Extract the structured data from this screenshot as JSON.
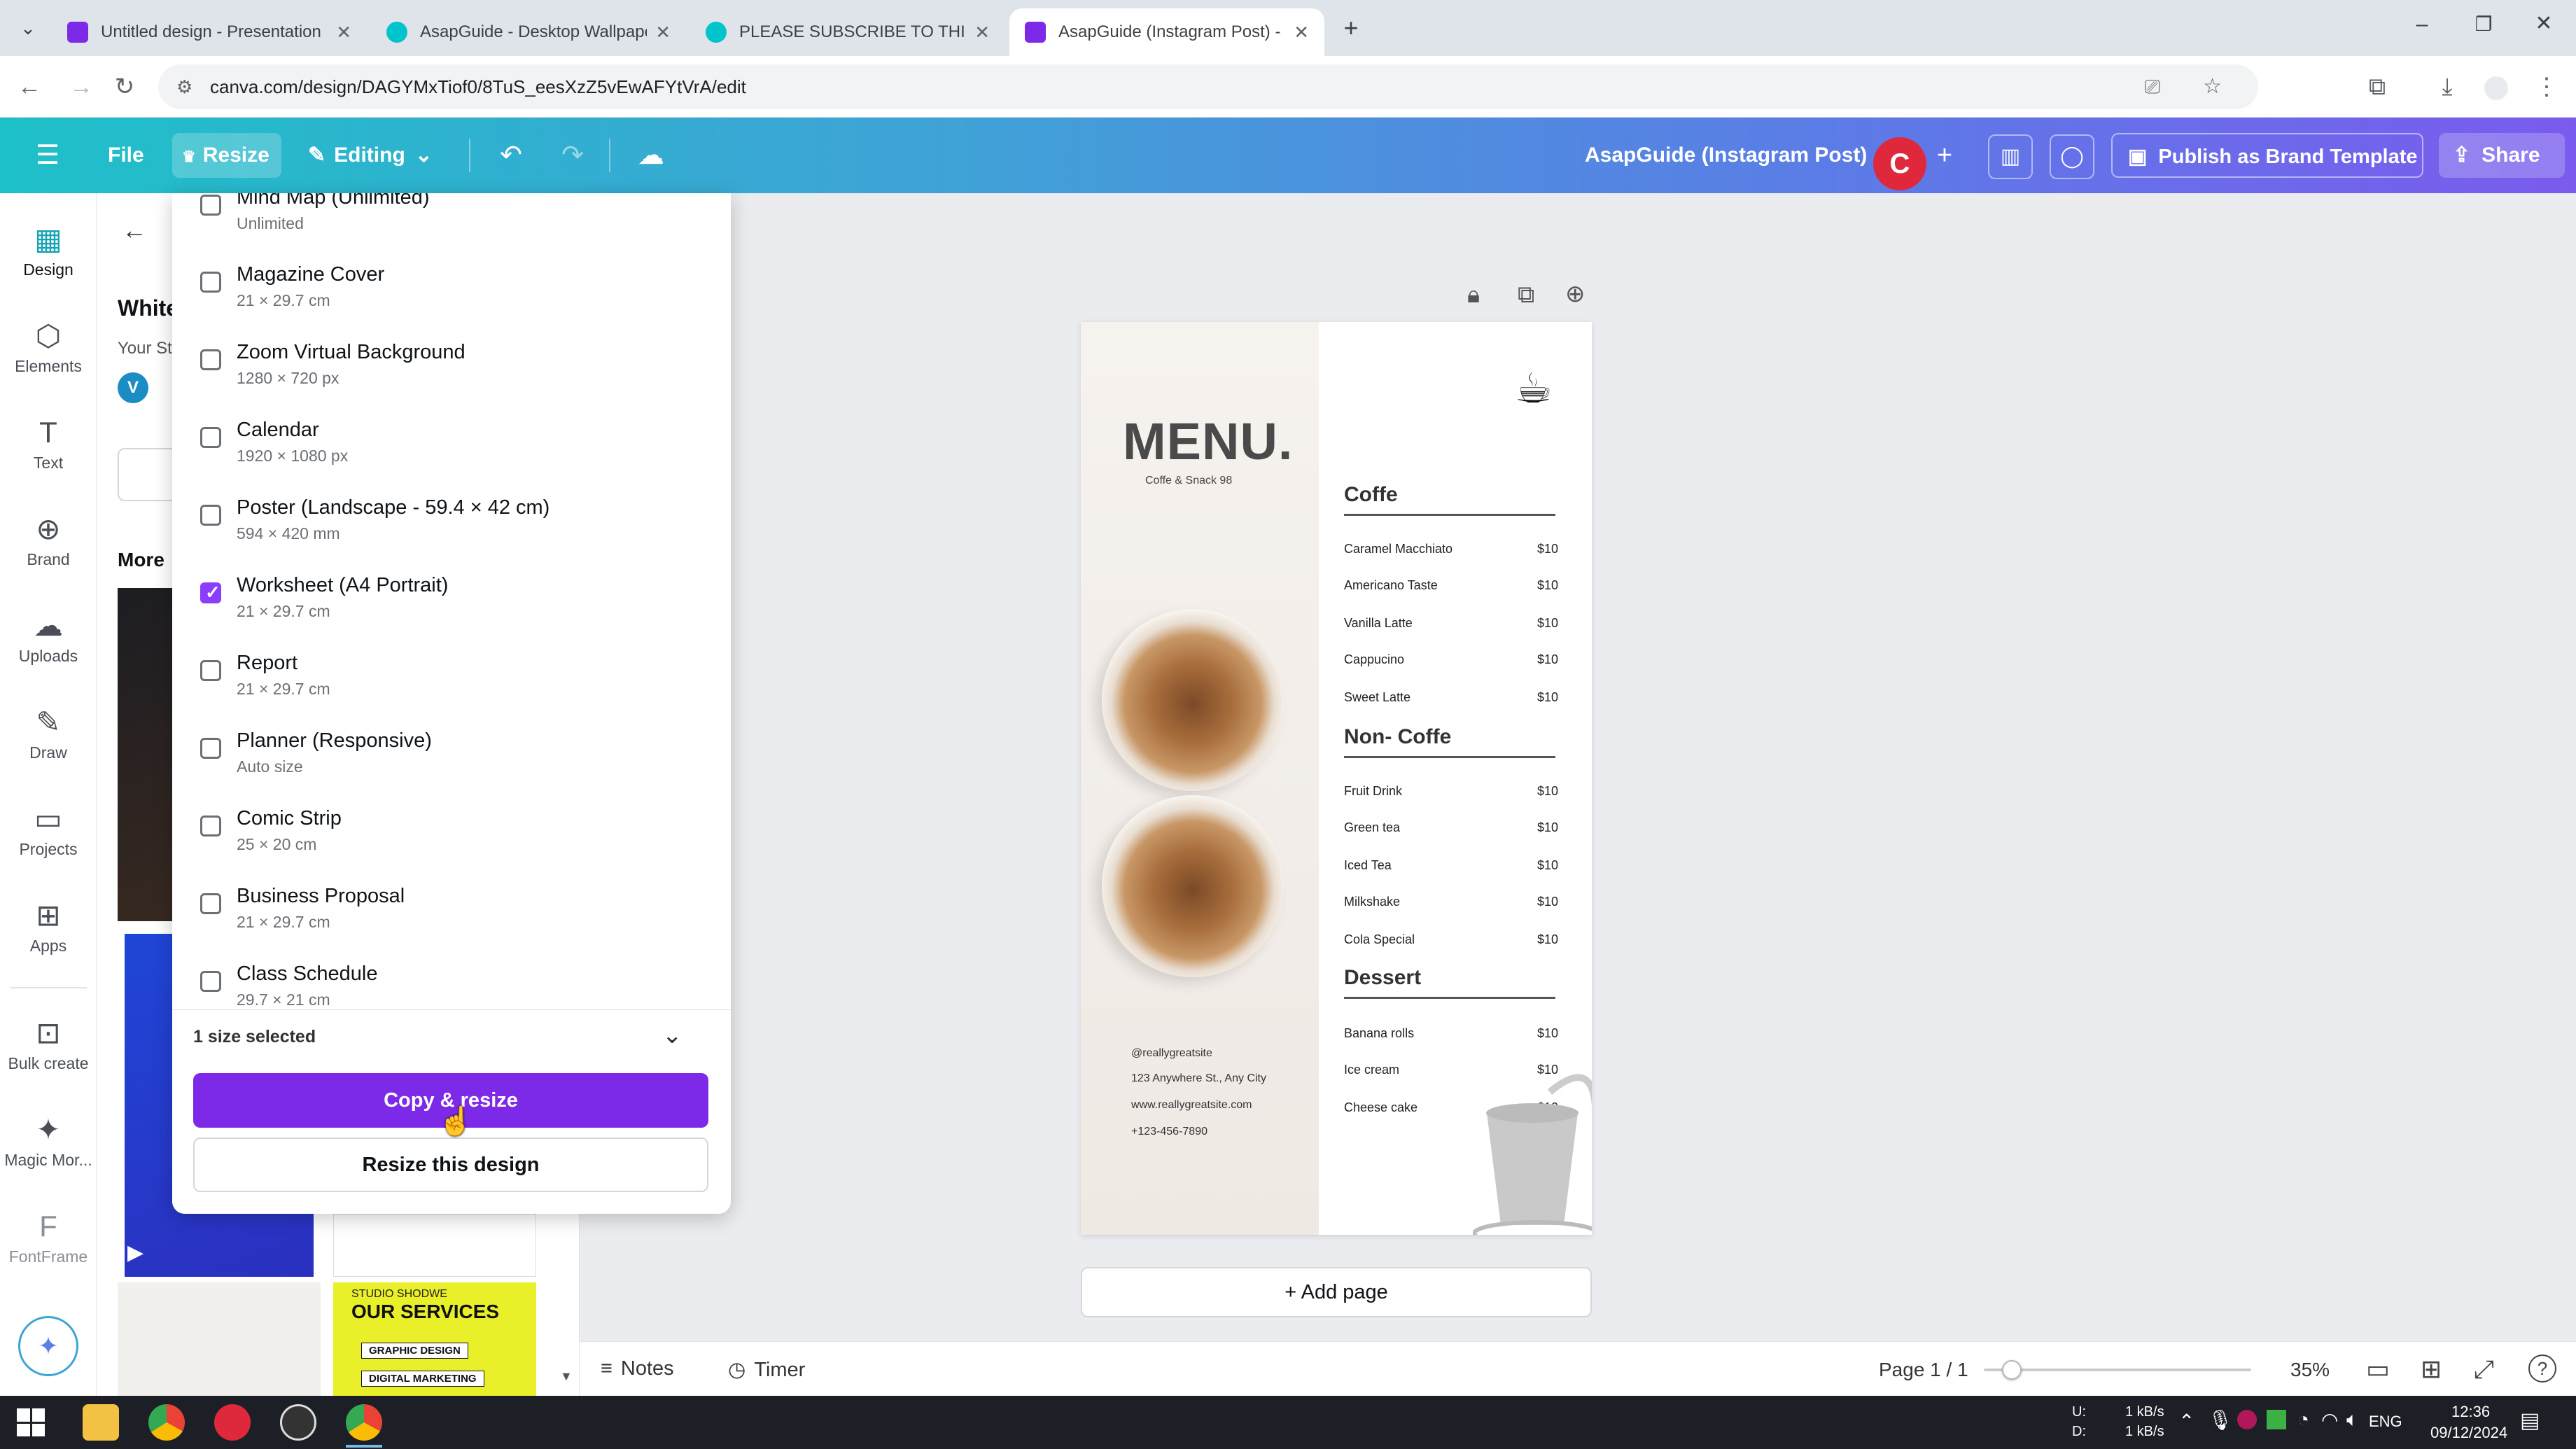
{
  "browser": {
    "tabs": [
      {
        "title": "Untitled design - Presentation",
        "fav_color": "#7d2ae8"
      },
      {
        "title": "AsapGuide - Desktop Wallpape",
        "fav_color": "#00c4cc"
      },
      {
        "title": "PLEASE SUBSCRIBE TO THIS CH",
        "fav_color": "#00c4cc"
      },
      {
        "title": "AsapGuide (Instagram Post) - Y",
        "fav_color": "#7d2ae8"
      }
    ],
    "url": "canva.com/design/DAGYMxTiof0/8TuS_eesXzZ5vEwAFYtVrA/edit"
  },
  "header": {
    "file": "File",
    "resize": "Resize",
    "editing": "Editing",
    "design_title": "AsapGuide (Instagram Post)",
    "avatar_letter": "C",
    "publish": "Publish as Brand Template",
    "share": "Share"
  },
  "rail": [
    {
      "label": "Design",
      "icon": "▦"
    },
    {
      "label": "Elements",
      "icon": "⬡"
    },
    {
      "label": "Text",
      "icon": "T"
    },
    {
      "label": "Brand",
      "icon": "⊕"
    },
    {
      "label": "Uploads",
      "icon": "☁"
    },
    {
      "label": "Draw",
      "icon": "✎"
    },
    {
      "label": "Projects",
      "icon": "▭"
    },
    {
      "label": "Apps",
      "icon": "⊞"
    },
    {
      "label": "Bulk create",
      "icon": "⊡"
    },
    {
      "label": "Magic Mor...",
      "icon": "✦"
    },
    {
      "label": "FontFrame",
      "icon": "F"
    }
  ],
  "sidepanel": {
    "heading_partial": "White",
    "sub_partial": "Your St",
    "avatar_letter": "V",
    "more_label": "More"
  },
  "resize_options": [
    {
      "name": "Mind Map (Unlimited)",
      "size": "Unlimited",
      "checked": false
    },
    {
      "name": "Magazine Cover",
      "size": "21 × 29.7 cm",
      "checked": false
    },
    {
      "name": "Zoom Virtual Background",
      "size": "1280 × 720 px",
      "checked": false
    },
    {
      "name": "Calendar",
      "size": "1920 × 1080 px",
      "checked": false
    },
    {
      "name": "Poster (Landscape - 59.4 × 42 cm)",
      "size": "594 × 420 mm",
      "checked": false
    },
    {
      "name": "Worksheet (A4 Portrait)",
      "size": "21 × 29.7 cm",
      "checked": true
    },
    {
      "name": "Report",
      "size": "21 × 29.7 cm",
      "checked": false
    },
    {
      "name": "Planner (Responsive)",
      "size": "Auto size",
      "checked": false
    },
    {
      "name": "Comic Strip",
      "size": "25 × 20 cm",
      "checked": false
    },
    {
      "name": "Business Proposal",
      "size": "21 × 29.7 cm",
      "checked": false
    },
    {
      "name": "Class Schedule",
      "size": "29.7 × 21 cm",
      "checked": false
    }
  ],
  "resize_footer": {
    "selected": "1 size selected",
    "copy_resize": "Copy & resize",
    "resize_this": "Resize this design"
  },
  "design": {
    "title": "MENU.",
    "subtitle": "Coffe & Snack 98",
    "sections": [
      {
        "name": "Coffe",
        "items": [
          [
            "Caramel Macchiato",
            "$10"
          ],
          [
            "Americano Taste",
            "$10"
          ],
          [
            "Vanilla Latte",
            "$10"
          ],
          [
            "Cappucino",
            "$10"
          ],
          [
            "Sweet Latte",
            "$10"
          ]
        ]
      },
      {
        "name": "Non- Coffe",
        "items": [
          [
            "Fruit Drink",
            "$10"
          ],
          [
            "Green tea",
            "$10"
          ],
          [
            "Iced Tea",
            "$10"
          ],
          [
            "Milkshake",
            "$10"
          ],
          [
            "Cola Special",
            "$10"
          ]
        ]
      },
      {
        "name": "Dessert",
        "items": [
          [
            "Banana rolls",
            "$10"
          ],
          [
            "Ice cream",
            "$10"
          ],
          [
            "Cheese cake",
            "$10"
          ]
        ]
      }
    ],
    "contact": [
      "@reallygreatsite",
      "123 Anywhere St., Any City",
      "www.reallygreatsite.com",
      "+123-456-7890"
    ]
  },
  "canvas": {
    "add_page": "+ Add page"
  },
  "status": {
    "notes": "Notes",
    "timer": "Timer",
    "page": "Page 1 / 1",
    "zoom": "35%",
    "zoom_fraction": 0.35
  },
  "panel_thumbs": {
    "services_title": "OUR SERVICES",
    "services_sub": "STUDIO SHODWE",
    "services_items": [
      "GRAPHIC DESIGN",
      "DIGITAL MARKETING"
    ]
  },
  "taskbar": {
    "net_up": "1 kB/s",
    "net_down": "1 kB/s",
    "net_up_label": "U:",
    "net_down_label": "D:",
    "lang": "ENG",
    "time": "12:36",
    "date": "09/12/2024"
  }
}
